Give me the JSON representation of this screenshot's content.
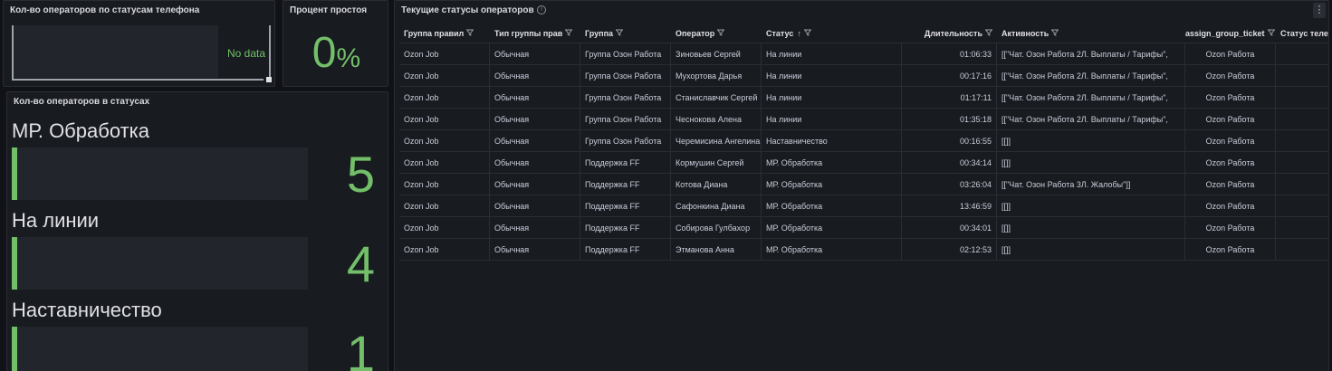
{
  "panel_phone_statuses": {
    "title": "Кол-во операторов по статусам телефона",
    "no_data": "No data"
  },
  "panel_idle_percent": {
    "title": "Процент простоя",
    "value": "0",
    "unit": "%"
  },
  "panel_operator_statuses": {
    "title": "Кол-во операторов в статусах",
    "max_value": 5,
    "bar_color": "#73bf69",
    "items": [
      {
        "label": "МР. Обработка",
        "value": 5
      },
      {
        "label": "На линии",
        "value": 4
      },
      {
        "label": "Наставничество",
        "value": 1
      }
    ]
  },
  "panel_table": {
    "title": "Текущие статусы операторов",
    "info_icon": "info-icon",
    "menu_icon": "⋮",
    "sort_icon": "↑",
    "columns": [
      "Группа правил",
      "Тип группы прав",
      "Группа",
      "Оператор",
      "Статус",
      "Длительность",
      "Активность",
      "assign_group_ticket",
      "Статус теле"
    ],
    "rows": [
      [
        "Ozon Job",
        "Обычная",
        "Группа Озон Работа",
        "Зиновьев Сергей",
        "На линии",
        "01:06:33",
        "[[\"Чат. Озон Работа 2Л. Выплаты / Тарифы\",",
        "Ozon Работа",
        ""
      ],
      [
        "Ozon Job",
        "Обычная",
        "Группа Озон Работа",
        "Мухортова Дарья",
        "На линии",
        "00:17:16",
        "[[\"Чат. Озон Работа 2Л. Выплаты / Тарифы\",",
        "Ozon Работа",
        ""
      ],
      [
        "Ozon Job",
        "Обычная",
        "Группа Озон Работа",
        "Станиславчик Сергей",
        "На линии",
        "01:17:11",
        "[[\"Чат. Озон Работа 2Л. Выплаты / Тарифы\",",
        "Ozon Работа",
        ""
      ],
      [
        "Ozon Job",
        "Обычная",
        "Группа Озон Работа",
        "Чеснокова Алена",
        "На линии",
        "01:35:18",
        "[[\"Чат. Озон Работа 2Л. Выплаты / Тарифы\",",
        "Ozon Работа",
        ""
      ],
      [
        "Ozon Job",
        "Обычная",
        "Группа Озон Работа",
        "Черемисина Ангелина",
        "Наставничество",
        "00:16:55",
        "[[]]",
        "Ozon Работа",
        ""
      ],
      [
        "Ozon Job",
        "Обычная",
        "Поддержка FF",
        "Кормушин Сергей",
        "МР. Обработка",
        "00:34:14",
        "[[]]",
        "Ozon Работа",
        ""
      ],
      [
        "Ozon Job",
        "Обычная",
        "Поддержка FF",
        "Котова Диана",
        "МР. Обработка",
        "03:26:04",
        "[[\"Чат. Озон Работа 3Л. Жалобы\"]]",
        "Ozon Работа",
        ""
      ],
      [
        "Ozon Job",
        "Обычная",
        "Поддержка FF",
        "Сафонкина Диана",
        "МР. Обработка",
        "13:46:59",
        "[[]]",
        "Ozon Работа",
        ""
      ],
      [
        "Ozon Job",
        "Обычная",
        "Поддержка FF",
        "Собирова Гулбахор",
        "МР. Обработка",
        "00:34:01",
        "[[]]",
        "Ozon Работа",
        ""
      ],
      [
        "Ozon Job",
        "Обычная",
        "Поддержка FF",
        "Этманова Анна",
        "МР. Обработка",
        "02:12:53",
        "[[]]",
        "Ozon Работа",
        ""
      ]
    ]
  }
}
